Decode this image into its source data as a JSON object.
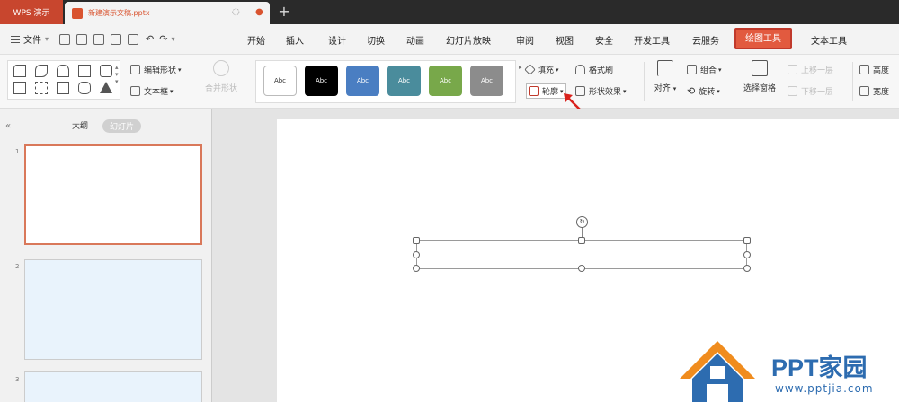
{
  "titlebar": {
    "app_tab": "WPS 演示",
    "doc_name": "新建演示文稿.pptx",
    "new_tab": "+"
  },
  "menubar": {
    "file": "文件",
    "items": [
      "开始",
      "插入",
      "设计",
      "切换",
      "动画",
      "幻灯片放映",
      "审阅",
      "视图",
      "安全",
      "开发工具",
      "云服务",
      "绘图工具",
      "文本工具"
    ],
    "active_index": 11
  },
  "ribbon": {
    "edit_shape": "编辑形状",
    "text_box": "文本框",
    "style_swatches": [
      {
        "label": "Abc",
        "color": "#ffffff",
        "text": "#333333"
      },
      {
        "label": "Abc",
        "color": "#000000",
        "text": "#ffffff"
      },
      {
        "label": "Abc",
        "color": "#4a7ec2",
        "text": "#ffffff"
      },
      {
        "label": "Abc",
        "color": "#4a8c9c",
        "text": "#ffffff"
      },
      {
        "label": "Abc",
        "color": "#78a84a",
        "text": "#ffffff"
      },
      {
        "label": "Abc",
        "color": "#8c8c8c",
        "text": "#ffffff"
      }
    ],
    "fill": "填充",
    "format_painter": "格式刷",
    "outline": "轮廓",
    "shape_effect": "形状效果",
    "align": "对齐",
    "combine": "组合",
    "rotate": "旋转",
    "selection_pane": "选择窗格",
    "bring_forward": "上移一层",
    "send_backward": "下移一层",
    "height": "高度",
    "width": "宽度"
  },
  "panel": {
    "tab_outline": "大纲",
    "tab_slides": "幻灯片",
    "slide_numbers": [
      "1",
      "2",
      "3"
    ]
  },
  "watermark": {
    "title": "PPT家园",
    "url": "www.pptjia.com",
    "colors": {
      "house_blue": "#2d6cb0",
      "house_orange": "#f08c1e"
    }
  },
  "colors": {
    "accent": "#e25a3f",
    "wps_red": "#c8462e"
  }
}
